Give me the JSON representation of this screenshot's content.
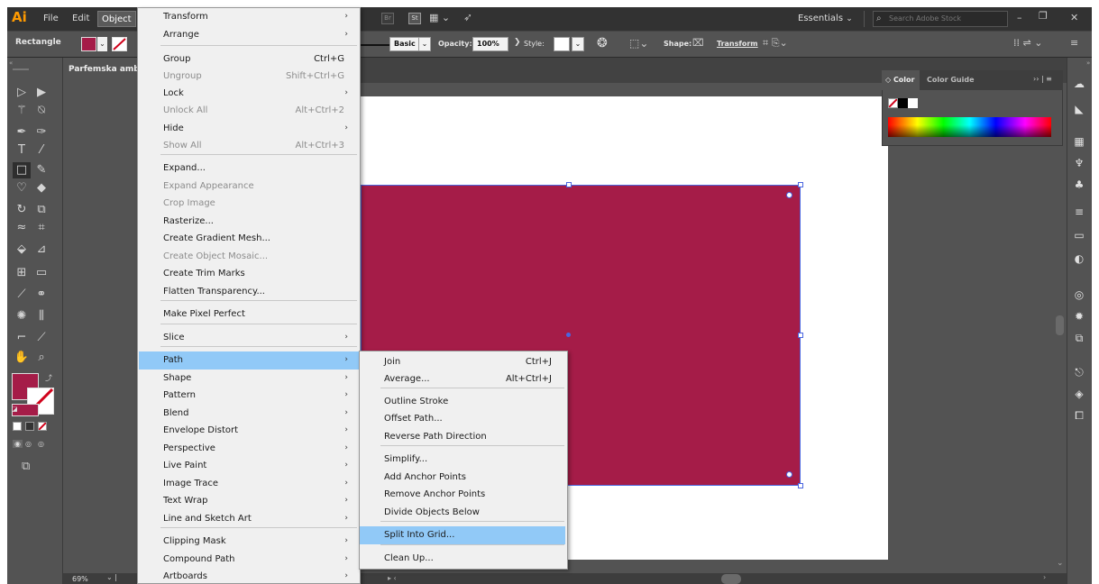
{
  "app": {
    "logo": "Ai"
  },
  "menubar": {
    "items": [
      "File",
      "Edit",
      "Object"
    ],
    "workspace": "Essentials",
    "search_placeholder": "Search Adobe Stock",
    "bridge": "Br",
    "stock": "St"
  },
  "controlbar": {
    "selection_type": "Rectangle",
    "fill_color": "#a51c48",
    "stroke_profile": "Basic",
    "opacity_label": "Opacity:",
    "opacity_value": "100%",
    "style_label": "Style:",
    "shape_label": "Shape:",
    "transform_label": "Transform"
  },
  "document": {
    "tab_title": "Parfemska amb",
    "zoom": "69%",
    "rect_fill": "#a51c48"
  },
  "color_panel": {
    "tabs": [
      "Color",
      "Color Guide"
    ]
  },
  "object_menu": {
    "items": [
      {
        "label": "Transform",
        "shortcut": "",
        "submenu": true,
        "enabled": true
      },
      {
        "label": "Arrange",
        "shortcut": "",
        "submenu": true,
        "enabled": true
      },
      {
        "label": "Group",
        "shortcut": "Ctrl+G",
        "submenu": false,
        "enabled": true
      },
      {
        "label": "Ungroup",
        "shortcut": "Shift+Ctrl+G",
        "submenu": false,
        "enabled": false
      },
      {
        "label": "Lock",
        "shortcut": "",
        "submenu": true,
        "enabled": true
      },
      {
        "label": "Unlock All",
        "shortcut": "Alt+Ctrl+2",
        "submenu": false,
        "enabled": false
      },
      {
        "label": "Hide",
        "shortcut": "",
        "submenu": true,
        "enabled": true
      },
      {
        "label": "Show All",
        "shortcut": "Alt+Ctrl+3",
        "submenu": false,
        "enabled": false
      },
      {
        "label": "Expand...",
        "shortcut": "",
        "submenu": false,
        "enabled": true
      },
      {
        "label": "Expand Appearance",
        "shortcut": "",
        "submenu": false,
        "enabled": false
      },
      {
        "label": "Crop Image",
        "shortcut": "",
        "submenu": false,
        "enabled": false
      },
      {
        "label": "Rasterize...",
        "shortcut": "",
        "submenu": false,
        "enabled": true
      },
      {
        "label": "Create Gradient Mesh...",
        "shortcut": "",
        "submenu": false,
        "enabled": true
      },
      {
        "label": "Create Object Mosaic...",
        "shortcut": "",
        "submenu": false,
        "enabled": false
      },
      {
        "label": "Create Trim Marks",
        "shortcut": "",
        "submenu": false,
        "enabled": true
      },
      {
        "label": "Flatten Transparency...",
        "shortcut": "",
        "submenu": false,
        "enabled": true
      },
      {
        "label": "Make Pixel Perfect",
        "shortcut": "",
        "submenu": false,
        "enabled": true
      },
      {
        "label": "Slice",
        "shortcut": "",
        "submenu": true,
        "enabled": true
      },
      {
        "label": "Path",
        "shortcut": "",
        "submenu": true,
        "enabled": true
      },
      {
        "label": "Shape",
        "shortcut": "",
        "submenu": true,
        "enabled": true
      },
      {
        "label": "Pattern",
        "shortcut": "",
        "submenu": true,
        "enabled": true
      },
      {
        "label": "Blend",
        "shortcut": "",
        "submenu": true,
        "enabled": true
      },
      {
        "label": "Envelope Distort",
        "shortcut": "",
        "submenu": true,
        "enabled": true
      },
      {
        "label": "Perspective",
        "shortcut": "",
        "submenu": true,
        "enabled": true
      },
      {
        "label": "Live Paint",
        "shortcut": "",
        "submenu": true,
        "enabled": true
      },
      {
        "label": "Image Trace",
        "shortcut": "",
        "submenu": true,
        "enabled": true
      },
      {
        "label": "Text Wrap",
        "shortcut": "",
        "submenu": true,
        "enabled": true
      },
      {
        "label": "Line and Sketch Art",
        "shortcut": "",
        "submenu": true,
        "enabled": true
      },
      {
        "label": "Clipping Mask",
        "shortcut": "",
        "submenu": true,
        "enabled": true
      },
      {
        "label": "Compound Path",
        "shortcut": "",
        "submenu": true,
        "enabled": true
      },
      {
        "label": "Artboards",
        "shortcut": "",
        "submenu": true,
        "enabled": true
      }
    ]
  },
  "path_submenu": {
    "items": [
      {
        "label": "Join",
        "shortcut": "Ctrl+J"
      },
      {
        "label": "Average...",
        "shortcut": "Alt+Ctrl+J"
      },
      {
        "label": "Outline Stroke",
        "shortcut": ""
      },
      {
        "label": "Offset Path...",
        "shortcut": ""
      },
      {
        "label": "Reverse Path Direction",
        "shortcut": ""
      },
      {
        "label": "Simplify...",
        "shortcut": ""
      },
      {
        "label": "Add Anchor Points",
        "shortcut": ""
      },
      {
        "label": "Remove Anchor Points",
        "shortcut": ""
      },
      {
        "label": "Divide Objects Below",
        "shortcut": ""
      },
      {
        "label": "Split Into Grid...",
        "shortcut": ""
      },
      {
        "label": "Clean Up...",
        "shortcut": ""
      }
    ]
  }
}
